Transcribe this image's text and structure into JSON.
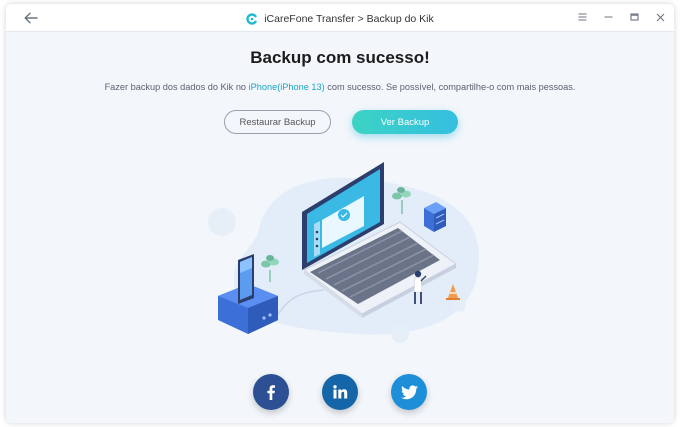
{
  "titlebar": {
    "title": "iCareFone Transfer > Backup do Kik",
    "back_icon": "arrow-left-icon",
    "controls": [
      "menu-icon",
      "minimize-icon",
      "maximize-icon",
      "close-icon"
    ]
  },
  "main": {
    "heading": "Backup com sucesso!",
    "subtext_before": "Fazer backup dos dados do Kik no ",
    "device_name": "iPhone(iPhone 13)",
    "subtext_after": " com sucesso. Se possível, compartilhe-o com mais pessoas.",
    "restore_button": "Restaurar Backup",
    "view_button": "Ver Backup"
  },
  "social": [
    {
      "name": "facebook",
      "icon": "facebook-icon",
      "color": "#2d4f93"
    },
    {
      "name": "linkedin",
      "icon": "linkedin-icon",
      "color": "#1566a8"
    },
    {
      "name": "twitter",
      "icon": "twitter-icon",
      "color": "#1d8fd8"
    }
  ],
  "colors": {
    "accent": "#35bfe0",
    "accent_start": "#3cd3c4",
    "background": "#f3f6fb",
    "device_highlight": "#1aa7c8"
  }
}
